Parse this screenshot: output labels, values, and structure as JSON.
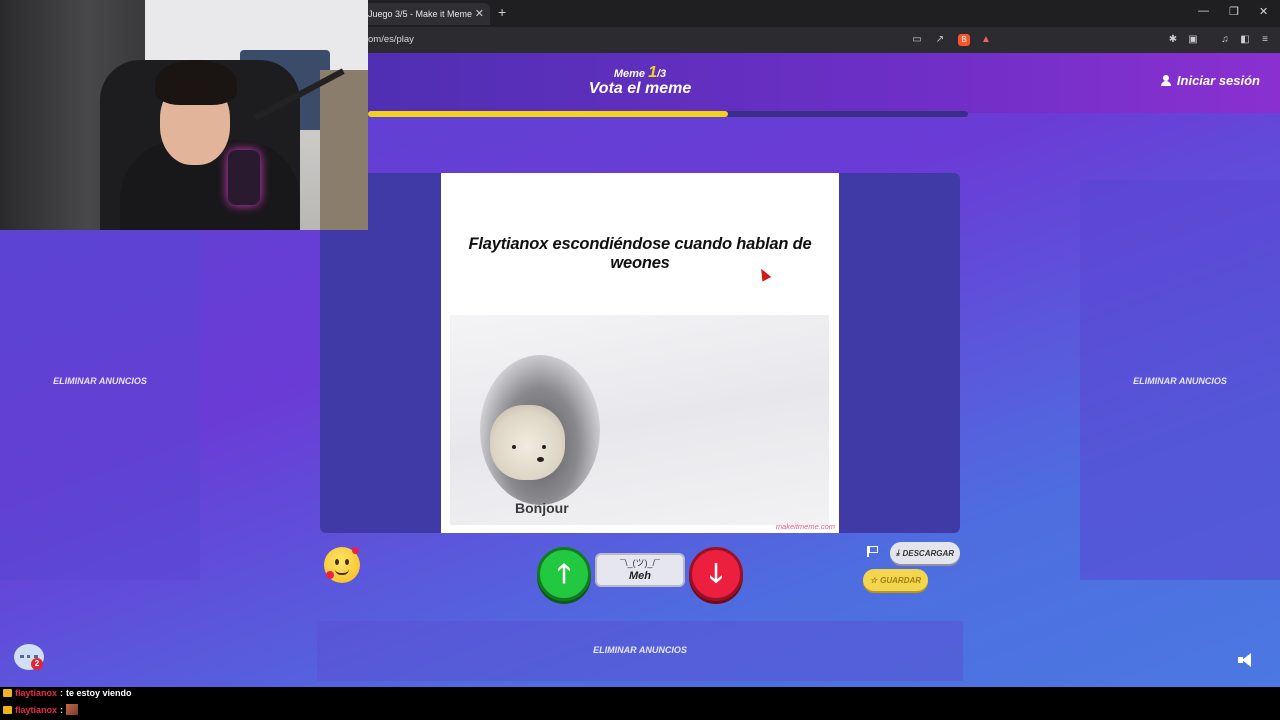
{
  "browser": {
    "tab_title": "Juego 3/5 - Make it Meme",
    "tab_close": "✕",
    "new_tab": "+",
    "url": "om/es/play",
    "window_controls": {
      "minimize": "—",
      "maximize": "❐",
      "close": "✕"
    }
  },
  "header": {
    "meme_word": "Meme",
    "meme_current": "1",
    "meme_total": "/3",
    "title": "Vota el meme",
    "login_label": "Iniciar sesión",
    "progress": 0.6
  },
  "ads": {
    "left_label": "ELIMINAR ANUNCIOS",
    "right_label": "ELIMINAR ANUNCIOS",
    "bottom_label": "ELIMINAR ANUNCIOS"
  },
  "meme": {
    "caption": "Flaytianox escondiéndose cuando hablan de weones",
    "image_text": "Bonjour",
    "watermark": "makeitmeme.com"
  },
  "vote": {
    "up_glyph": "🡑",
    "down_glyph": "🡓",
    "meh_face": "¯\\_(ツ)_/¯",
    "meh_label": "Meh"
  },
  "actions": {
    "download_label": "DESCARGAR",
    "save_label": "GUARDAR",
    "download_glyph": "⤓",
    "save_glyph": "☆"
  },
  "chat_widget": {
    "badge_count": "2"
  },
  "stream_chat": [
    {
      "user": "flaytianox",
      "message": "te estoy viendo"
    },
    {
      "user": "flaytianox",
      "message": ""
    }
  ],
  "colors": {
    "accent_yellow": "#f3d21d",
    "vote_up": "#22c840",
    "vote_down": "#ec1f3f",
    "chat_user": "#e8294c"
  }
}
